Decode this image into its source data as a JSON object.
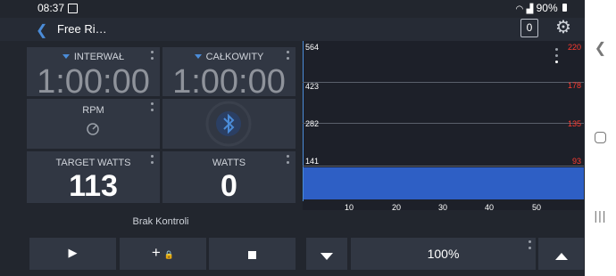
{
  "status_bar": {
    "time": "08:37",
    "battery": "90%",
    "image_icon": "image-icon",
    "wifi_icon": "wifi-icon",
    "signal_icon": "signal-icon",
    "battery_icon": "battery-icon"
  },
  "app_bar": {
    "title": "Free Ri…",
    "count": "0",
    "back_icon": "back-arrow-icon",
    "settings_icon": "gear-icon"
  },
  "tiles": {
    "interval": {
      "label": "INTERWAŁ",
      "value": "1:00:00"
    },
    "total": {
      "label": "CAŁKOWITY",
      "value": "1:00:00"
    },
    "rpm": {
      "label": "RPM",
      "icon": "gauge-icon"
    },
    "bluetooth": {
      "icon": "bluetooth-icon"
    },
    "target_watts": {
      "label": "TARGET WATTS",
      "value": "113"
    },
    "watts": {
      "label": "WATTS",
      "value": "0"
    }
  },
  "chart_data": {
    "type": "area",
    "y_ticks": [
      "564",
      "423",
      "282",
      "141"
    ],
    "y2_ticks": [
      "220",
      "178",
      "135",
      "93"
    ],
    "x_ticks": [
      "10",
      "20",
      "30",
      "40",
      "50"
    ],
    "series": [
      {
        "values": [
          113,
          113,
          113,
          113,
          113,
          113
        ]
      }
    ],
    "ylim": [
      0,
      564
    ],
    "colors": {
      "series": "#2e5fc5",
      "y2": "#ff3b30"
    }
  },
  "status_text": "Brak Kontroli",
  "controls": {
    "play_icon": "play-icon",
    "add_icon": "plus-icon",
    "lock_icon": "lock-icon",
    "stop_icon": "stop-icon",
    "down_icon": "triangle-down-icon",
    "percent": "100%",
    "up_icon": "triangle-up-icon"
  },
  "nav": {
    "back": "back-icon",
    "home": "home-icon",
    "recents": "recents-icon"
  }
}
